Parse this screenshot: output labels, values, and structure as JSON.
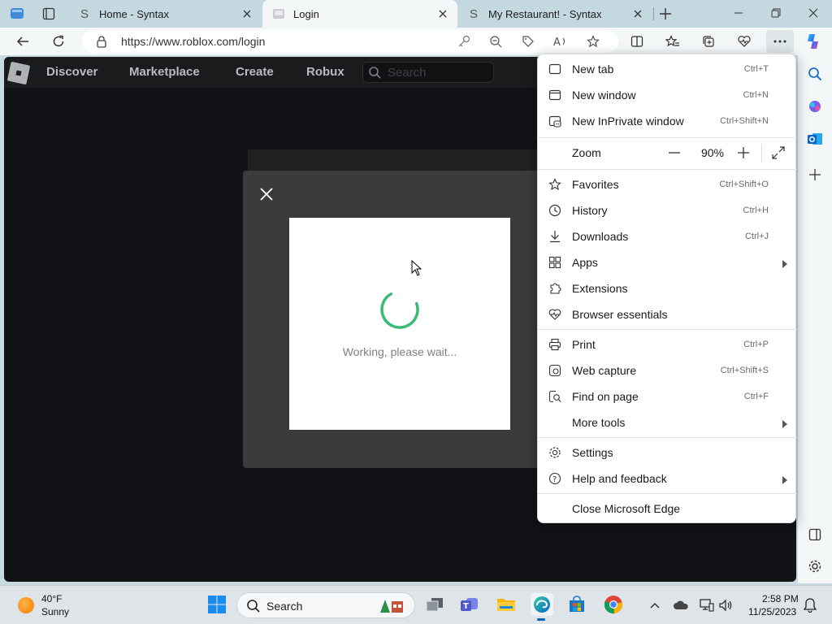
{
  "tabs": [
    {
      "title": "Home - Syntax",
      "favicon": "syntax-favicon"
    },
    {
      "title": "Login",
      "favicon": "roblox-favicon"
    },
    {
      "title": "My Restaurant!      - Syntax",
      "favicon": "syntax-favicon"
    }
  ],
  "address": {
    "url": "https://www.roblox.com/login"
  },
  "site_nav": {
    "discover": "Discover",
    "marketplace": "Marketplace",
    "create": "Create",
    "robux": "Robux",
    "search_placeholder": "Search"
  },
  "captcha": {
    "working_text": "Working, please wait..."
  },
  "menu": {
    "new_tab": {
      "label": "New tab",
      "shortcut": "Ctrl+T"
    },
    "new_window": {
      "label": "New window",
      "shortcut": "Ctrl+N"
    },
    "new_inprivate": {
      "label": "New InPrivate window",
      "shortcut": "Ctrl+Shift+N"
    },
    "zoom": {
      "label": "Zoom",
      "value": "90%"
    },
    "favorites": {
      "label": "Favorites",
      "shortcut": "Ctrl+Shift+O"
    },
    "history": {
      "label": "History",
      "shortcut": "Ctrl+H"
    },
    "downloads": {
      "label": "Downloads",
      "shortcut": "Ctrl+J"
    },
    "apps": {
      "label": "Apps"
    },
    "extensions": {
      "label": "Extensions"
    },
    "browser_essentials": {
      "label": "Browser essentials"
    },
    "print": {
      "label": "Print",
      "shortcut": "Ctrl+P"
    },
    "web_capture": {
      "label": "Web capture",
      "shortcut": "Ctrl+Shift+S"
    },
    "find_on_page": {
      "label": "Find on page",
      "shortcut": "Ctrl+F"
    },
    "more_tools": {
      "label": "More tools"
    },
    "settings": {
      "label": "Settings"
    },
    "help": {
      "label": "Help and feedback"
    },
    "close_edge": {
      "label": "Close Microsoft Edge"
    }
  },
  "taskbar": {
    "weather_temp": "40°F",
    "weather_cond": "Sunny",
    "search_label": "Search",
    "time": "2:58 PM",
    "date": "11/25/2023"
  },
  "colors": {
    "accent": "#0067c0",
    "spinner": "#3cb878",
    "roblox_bg": "#121317"
  }
}
